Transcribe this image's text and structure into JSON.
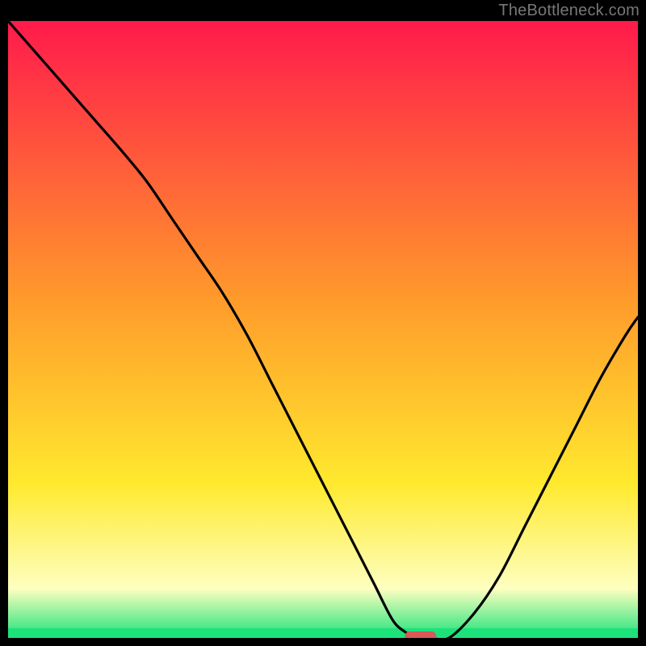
{
  "watermark": "TheBottleneck.com",
  "colors": {
    "frame": "#000000",
    "curve": "#000000",
    "marker": "#d65a5a",
    "grad_top": "#ff1a4b",
    "grad_orange": "#ff9a2b",
    "grad_yellow": "#ffe92e",
    "grad_pale": "#feffc0",
    "grad_green": "#1de27a"
  },
  "chart_data": {
    "type": "line",
    "title": "",
    "xlabel": "",
    "ylabel": "",
    "xlim": [
      0,
      100
    ],
    "ylim": [
      0,
      100
    ],
    "x": [
      0,
      6,
      12,
      18,
      22,
      26,
      30,
      34,
      38,
      42,
      46,
      50,
      54,
      58,
      61,
      63,
      65,
      67,
      70,
      74,
      78,
      82,
      86,
      90,
      94,
      98,
      100
    ],
    "y": [
      100,
      93,
      86,
      79,
      74,
      68,
      62,
      56,
      49,
      41,
      33,
      25,
      17,
      9,
      3,
      1,
      0,
      0,
      0,
      4,
      10,
      18,
      26,
      34,
      42,
      49,
      52
    ],
    "marker": {
      "x_range": [
        63,
        68
      ],
      "y": 0
    }
  }
}
